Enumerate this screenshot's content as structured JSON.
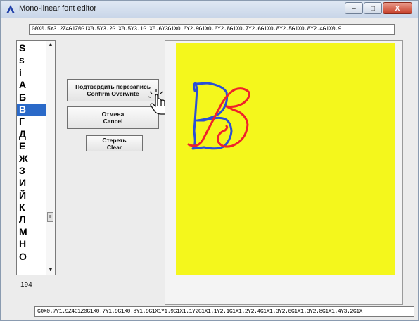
{
  "window": {
    "title": "Mono-linear font editor",
    "controls": {
      "minimize": "–",
      "maximize": "□",
      "close": "X"
    }
  },
  "command_top": "G0X0.5Y3.2Z4G1Z0G1X0.5Y3.2G1X0.5Y3.1G1X0.6Y3G1X0.6Y2.9G1X0.6Y2.8G1X0.7Y2.6G1X0.8Y2.5G1X0.8Y2.4G1X0.9",
  "command_bottom": "G0X0.7Y1.9Z4G1Z0G1X0.7Y1.9G1X0.8Y1.9G1X1Y1.9G1X1.1Y2G1X1.1Y2.1G1X1.2Y2.4G1X1.3Y2.6G1X1.3Y2.8G1X1.4Y3.2G1X",
  "char_list": {
    "items": [
      "S",
      "s",
      "i",
      "А",
      "Б",
      "В",
      "Г",
      "Д",
      "Е",
      "Ж",
      "З",
      "И",
      "Й",
      "К",
      "Л",
      "М",
      "Н",
      "О"
    ],
    "selected": "В",
    "scroll_up": "▲",
    "scroll_down": "▼",
    "thumb": "≡"
  },
  "glyph_count": "194",
  "buttons": {
    "confirm": {
      "line1": "Подтвердить перезапись",
      "line2": "Confirm Overwrite"
    },
    "cancel": {
      "line1": "Отмена",
      "line2": "Cancel"
    },
    "clear": {
      "line1": "Стереть",
      "line2": "Clear"
    }
  },
  "colors": {
    "draw_area": "#f4f71c",
    "stroke_blue": "#2a4fd6",
    "stroke_red": "#f0222a",
    "selection": "#2a69c8"
  }
}
